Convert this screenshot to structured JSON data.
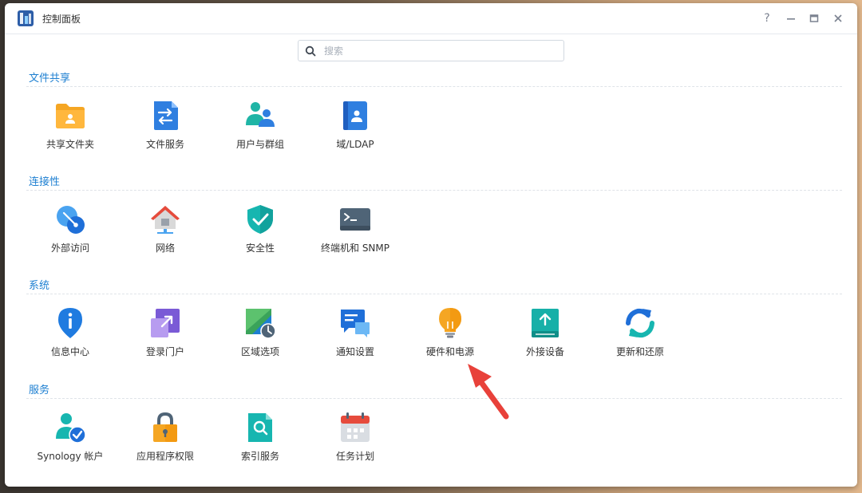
{
  "window": {
    "title": "控制面板",
    "controls": {
      "help": "?",
      "minimize": "—",
      "maximize": "▭",
      "close": "✕"
    }
  },
  "search": {
    "placeholder": "搜索",
    "value": ""
  },
  "sections": [
    {
      "title": "文件共享",
      "items": [
        {
          "label": "共享文件夹",
          "icon": "shared-folder-icon"
        },
        {
          "label": "文件服务",
          "icon": "file-services-icon"
        },
        {
          "label": "用户与群组",
          "icon": "user-group-icon"
        },
        {
          "label": "域/LDAP",
          "icon": "domain-ldap-icon"
        }
      ]
    },
    {
      "title": "连接性",
      "items": [
        {
          "label": "外部访问",
          "icon": "external-access-icon"
        },
        {
          "label": "网络",
          "icon": "network-icon"
        },
        {
          "label": "安全性",
          "icon": "security-shield-icon"
        },
        {
          "label": "终端机和 SNMP",
          "icon": "terminal-icon"
        }
      ]
    },
    {
      "title": "系统",
      "items": [
        {
          "label": "信息中心",
          "icon": "info-center-icon"
        },
        {
          "label": "登录门户",
          "icon": "login-portal-icon"
        },
        {
          "label": "区域选项",
          "icon": "regional-options-icon"
        },
        {
          "label": "通知设置",
          "icon": "notification-icon"
        },
        {
          "label": "硬件和电源",
          "icon": "hardware-power-bulb-icon"
        },
        {
          "label": "外接设备",
          "icon": "external-devices-icon"
        },
        {
          "label": "更新和还原",
          "icon": "update-restore-icon"
        }
      ]
    },
    {
      "title": "服务",
      "items": [
        {
          "label": "Synology 帐户",
          "icon": "synology-account-icon"
        },
        {
          "label": "应用程序权限",
          "icon": "app-privileges-lock-icon"
        },
        {
          "label": "索引服务",
          "icon": "indexing-service-icon"
        },
        {
          "label": "任务计划",
          "icon": "task-scheduler-calendar-icon"
        }
      ]
    }
  ],
  "colors": {
    "accent": "#1d7fd1",
    "annotation_arrow": "#e8413a"
  }
}
